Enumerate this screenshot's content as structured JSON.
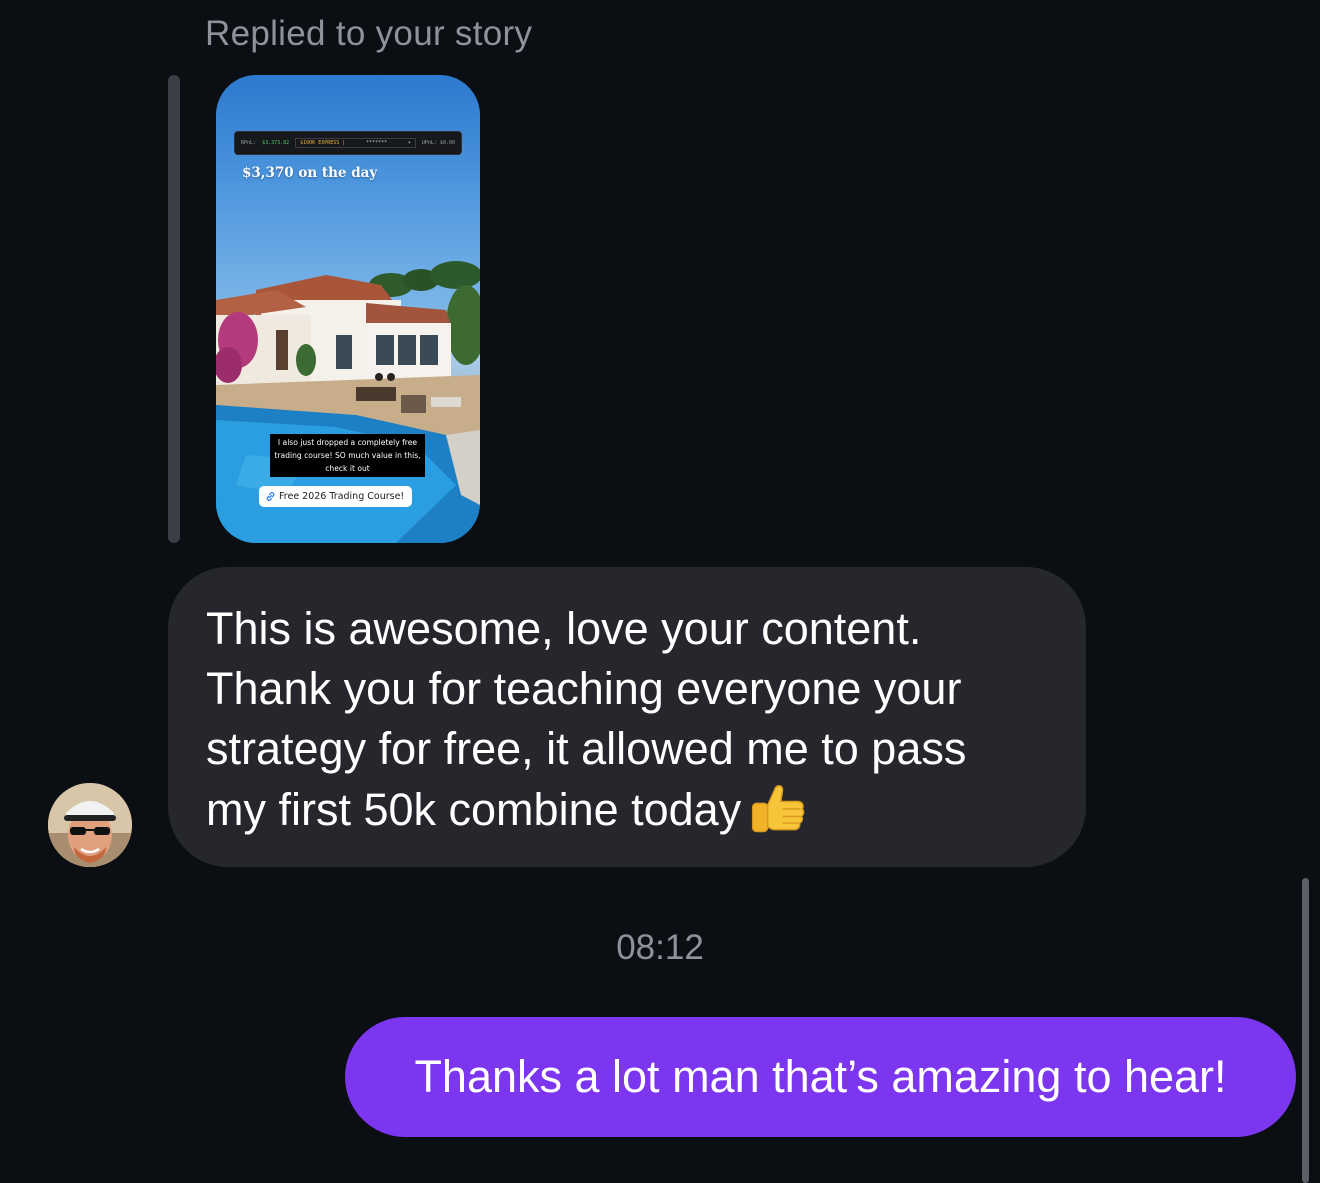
{
  "reply": {
    "header": "Replied to your story"
  },
  "story": {
    "ticker": {
      "pnl_label": "RPnL:",
      "pnl_value": "$3,373.82",
      "account": "$100K EXPRESS |",
      "account_masked": "*******",
      "upnl": "UPnL: $0.00"
    },
    "title": "$3,370 on the day",
    "caption_lines": [
      "I also just dropped a completely free",
      "trading course! SO much value in this,",
      "check it out"
    ],
    "link_label": "Free 2026 Trading Course!",
    "link_icon": "link-icon"
  },
  "incoming_message": {
    "lines": [
      "This is awesome, love your content.",
      "Thank you for teaching everyone your",
      "strategy for free, it allowed me to pass",
      "my first 50k combine today"
    ],
    "emoji": "thumbs-up-emoji"
  },
  "timestamp": "08:12",
  "outgoing_message": {
    "text": "Thanks a lot man that’s amazing to hear!"
  },
  "colors": {
    "background": "#0b0e12",
    "incoming_bubble": "#25272c",
    "outgoing_bubble": "#7d36f0",
    "muted_text": "#8e939b"
  }
}
